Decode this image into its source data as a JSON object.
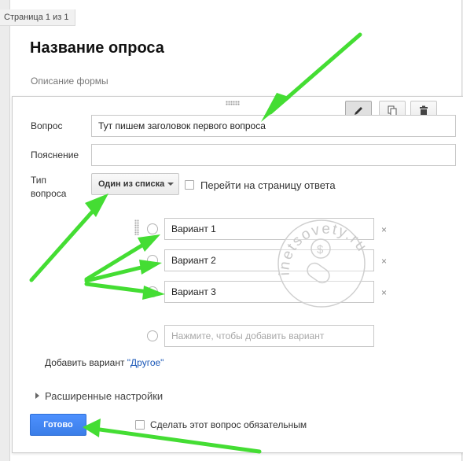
{
  "page_indicator": "Страница 1 из 1",
  "form": {
    "title": "Название опроса",
    "description": "Описание формы"
  },
  "question": {
    "question_label": "Вопрос",
    "question_value": "Тут пишем заголовок первого вопроса",
    "help_label": "Пояснение",
    "help_value": "",
    "type_label_line1": "Тип",
    "type_label_line2": "вопроса",
    "type_value": "Один из списка",
    "goto_page_label": "Перейти на страницу ответа",
    "options": [
      {
        "value": "Вариант 1"
      },
      {
        "value": "Вариант 2"
      },
      {
        "value": "Вариант 3"
      }
    ],
    "add_option_placeholder": "Нажмите, чтобы добавить вариант",
    "add_other_prefix": "Добавить вариант ",
    "add_other_link": "\"Другое\"",
    "advanced_settings": "Расширенные настройки",
    "done_button": "Готово",
    "required_label": "Сделать этот вопрос обязательным",
    "option_remove_glyph": "×"
  },
  "toolbar": {
    "icons": [
      "pencil-icon",
      "copy-icon",
      "trash-icon"
    ]
  },
  "watermark": {
    "text": "inetsovety.ru"
  },
  "colors": {
    "accent_button": "#4d90fe",
    "link": "#1a57b7",
    "annotation_arrow": "#44dd33"
  }
}
